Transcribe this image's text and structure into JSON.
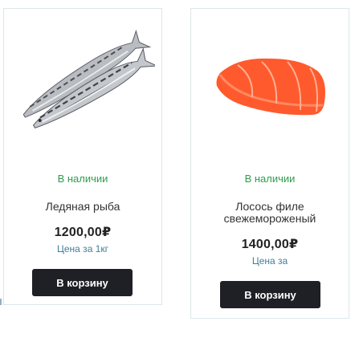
{
  "products": [
    {
      "image_alt": "fish-image",
      "availability": "В наличии",
      "name": "Ледяная рыба",
      "price": "1200,00₽",
      "unit_label": "Цена за 1кг",
      "button_label": "В корзину"
    },
    {
      "image_alt": "salmon-image",
      "availability": "В наличии",
      "name": "Лосось филе свежемороженый",
      "price": "1400,00₽",
      "unit_label": "Цена за",
      "button_label": "В корзину"
    }
  ],
  "colors": {
    "availability": "#2e9e4c",
    "unit_label": "#3f7f9a",
    "button_bg": "#1f2025",
    "card_border": "#dde6ea",
    "salmon": "#ff5a2d"
  }
}
